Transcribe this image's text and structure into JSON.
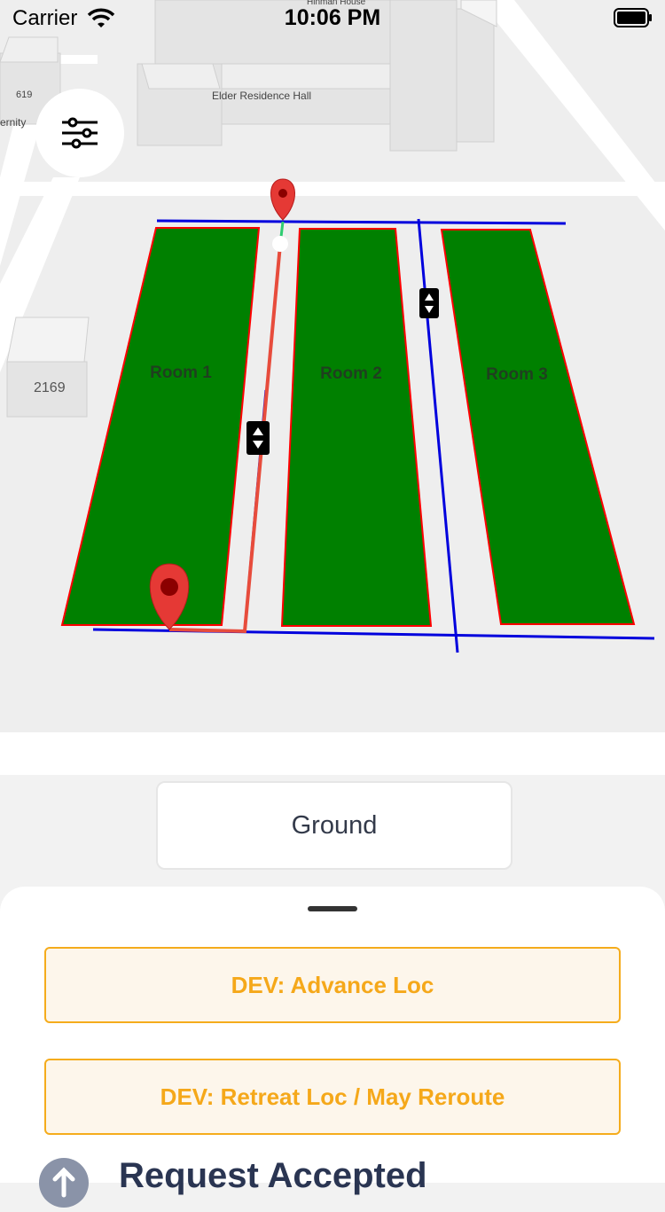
{
  "status_bar": {
    "carrier": "Carrier",
    "time": "10:06 PM"
  },
  "map": {
    "labels": {
      "elder_hall": "Elder Residence Hall",
      "hinman": "Hinman House",
      "address_619": "619",
      "address_2169": "2169",
      "fraternity_partial": "ernity"
    },
    "rooms": [
      {
        "label": "Room 1"
      },
      {
        "label": "Room 2"
      },
      {
        "label": "Room 3"
      }
    ],
    "colors": {
      "room_fill": "#008000",
      "room_stroke": "#ff0000",
      "route": "#e74c3c",
      "corridor": "#0000dd",
      "pin": "#e53935"
    }
  },
  "filter_button": {
    "icon": "sliders-icon"
  },
  "floor_selector": {
    "value": "Ground"
  },
  "sheet": {
    "advance_button": "DEV: Advance Loc",
    "retreat_button": "DEV: Retreat Loc / May Reroute",
    "status_title": "Request Accepted",
    "status_icon": "arrow-up-icon",
    "accent": "#f5ac1c"
  }
}
